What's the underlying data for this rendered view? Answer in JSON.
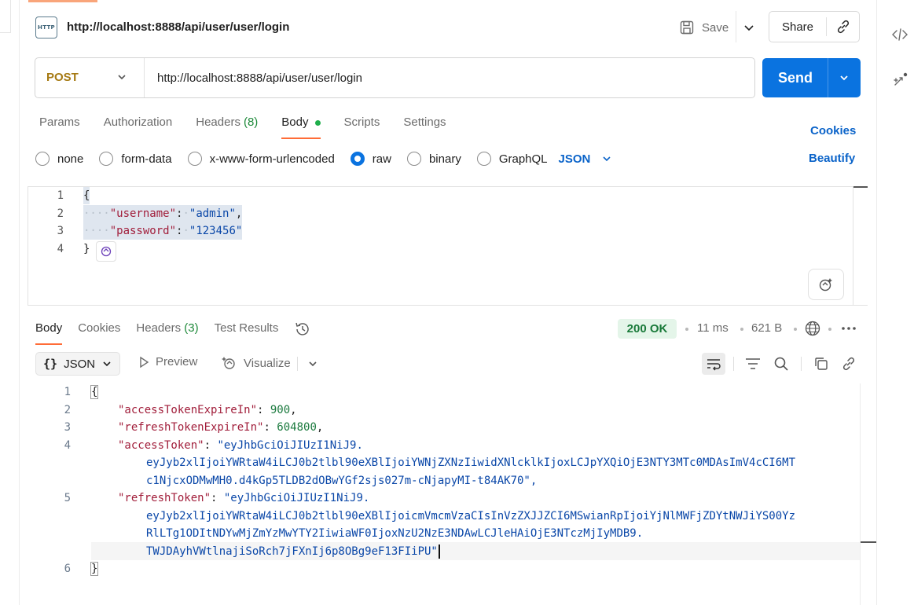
{
  "request": {
    "title": "http://localhost:8888/api/user/user/login",
    "http_badge": "HTTP",
    "save_label": "Save",
    "share_label": "Share",
    "method": "POST",
    "url": "http://localhost:8888/api/user/user/login",
    "send_label": "Send",
    "tabs": [
      {
        "label": "Params"
      },
      {
        "label": "Authorization"
      },
      {
        "label": "Headers",
        "count": "(8)"
      },
      {
        "label": "Body"
      },
      {
        "label": "Scripts"
      },
      {
        "label": "Settings"
      }
    ],
    "active_tab": "Body",
    "cookies_label": "Cookies",
    "body_modes": [
      "none",
      "form-data",
      "x-www-form-urlencoded",
      "raw",
      "binary",
      "GraphQL"
    ],
    "selected_mode": "raw",
    "format": "JSON",
    "beautify_label": "Beautify",
    "body_lines": [
      {
        "n": "1",
        "text": "{"
      },
      {
        "n": "2",
        "key": "\"username\"",
        "value": "\"admin\"",
        "trail": ","
      },
      {
        "n": "3",
        "key": "\"password\"",
        "value": "\"123456\"",
        "trail": ""
      },
      {
        "n": "4",
        "text": "}"
      }
    ]
  },
  "response": {
    "tabs": [
      {
        "label": "Body"
      },
      {
        "label": "Cookies"
      },
      {
        "label": "Headers",
        "count": "(3)"
      },
      {
        "label": "Test Results"
      }
    ],
    "active_tab": "Body",
    "status": "200 OK",
    "time": "11 ms",
    "size": "621 B",
    "format": "JSON",
    "preview_label": "Preview",
    "visualize_label": "Visualize",
    "lines": [
      {
        "n": "1",
        "text": "{"
      },
      {
        "n": "2",
        "key": "\"accessTokenExpireIn\"",
        "value": "900",
        "trail": ","
      },
      {
        "n": "3",
        "key": "\"refreshTokenExpireIn\"",
        "value": "604800",
        "trail": ","
      },
      {
        "n": "4",
        "key": "\"accessToken\"",
        "value_lines": [
          "\"eyJhbGciOiJIUzI1NiJ9.",
          "eyJyb2xlIjoiYWRtaW4iLCJ0b2tlbl90eXBlIjoiYWNjZXNzIiwidXNlcklkIjoxLCJpYXQiOjE3NTY3MTc0MDAsImV4cCI6MT",
          "c1NjcxODMwMH0.d4kGp5TLDB2dOBwYGf2sjs027m-cNjapyMI-t84AK70\","
        ]
      },
      {
        "n": "5",
        "key": "\"refreshToken\"",
        "value_lines": [
          "\"eyJhbGciOiJIUzI1NiJ9.",
          "eyJyb2xlIjoiYWRtaW4iLCJ0b2tlbl90eXBlIjoicmVmcmVzaCIsInVzZXJJZCI6MSwianRpIjoiYjNlMWFjZDYtNWJiYS00Yz",
          "RlLTg1ODItNDYwMjZmYzMwYTY2IiwiaWF0IjoxNzU2NzE3NDAwLCJleHAiOjE3NTczMjIyMDB9.",
          "TWJDAyhVWtlnajiSoRch7jFXnIj6p8OBg9eF13FIiPU\""
        ]
      },
      {
        "n": "6",
        "text": "}"
      }
    ]
  },
  "colors": {
    "accent": "#ff6c37",
    "send": "#0a73e0",
    "method": "#a67a13",
    "link": "#0a63c9",
    "status_ok": "#1a7a3a"
  },
  "icons": [
    "http-icon",
    "save-icon",
    "chevron-down-icon",
    "link-icon",
    "code-icon",
    "magic-icon",
    "history-icon",
    "globe-icon",
    "more-icon",
    "play-icon",
    "visualize-icon",
    "wrap-icon",
    "filter-icon",
    "search-icon",
    "copy-icon"
  ]
}
